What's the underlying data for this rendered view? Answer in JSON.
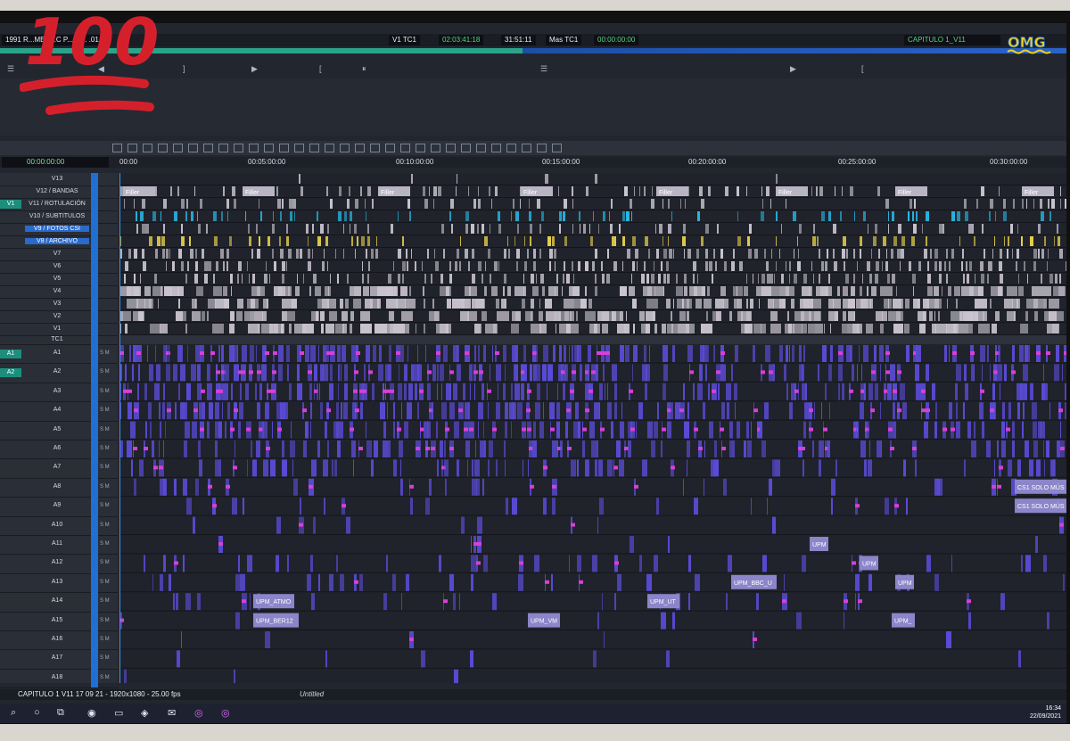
{
  "topbar": {
    "sequence_name": "1991 R...MER...C P... 1 ... .01",
    "source_label": "V1  TC1",
    "source_tc": "02:03:41:18",
    "duration_tc": "31:51:11",
    "record_label": "Mas  TC1",
    "record_tc": "00:00:00:00",
    "record_name": "CAPITULO 1_V11"
  },
  "timeline": {
    "position_tc": "00:00:00:00",
    "ruler_ticks": [
      "00:00",
      "00:05:00:00",
      "00:10:00:00",
      "00:15:00:00",
      "00:20:00:00",
      "00:25:00:00",
      "00:30:00:00"
    ],
    "filler_label": "Filler",
    "video_tracks": [
      "V13",
      "V12 / BANDAS",
      "V11 / ROTULACIÓN",
      "V10 / SUBTITULOS",
      "V9 / FOTOS CSI",
      "V8 / ARCHIVO",
      "V7",
      "V6",
      "V5",
      "V4",
      "V3",
      "V2",
      "V1"
    ],
    "tc_track": "TC1",
    "audio_tracks": [
      "A1",
      "A2",
      "A3",
      "A4",
      "A5",
      "A6",
      "A7",
      "A8",
      "A9",
      "A10",
      "A11",
      "A12",
      "A13",
      "A14",
      "A15",
      "A16",
      "A17",
      "A18"
    ],
    "record_video": "V1",
    "record_audio": [
      "A1",
      "A2"
    ],
    "clip_labels": [
      "UPM_ATMO",
      "UPM_BER12",
      "UPM_BBC_U",
      "UPM_UT",
      "UPM_VM",
      "CS1 SOLO MÚS",
      "CS1 SOLO MÚS",
      "UPM",
      "UPM",
      "UPM",
      "UPM_"
    ],
    "colors": {
      "video_clip": "#c9c4cf",
      "audio_clip": "#5a4bd6",
      "subtitle": "#2ab8e6",
      "archive": "#e7d24a",
      "keyframe": "#d640d8",
      "selection": "#1f6fd4"
    }
  },
  "status": {
    "sequence_info": "CAPITULO 1 V11 17 09 21 - 1920x1080 - 25.00 fps",
    "bin_label": "Untitled"
  },
  "clock": {
    "time": "16:34",
    "date": "22/09/2021"
  },
  "overlays": {
    "hundred": "100",
    "omg": "OMG"
  }
}
